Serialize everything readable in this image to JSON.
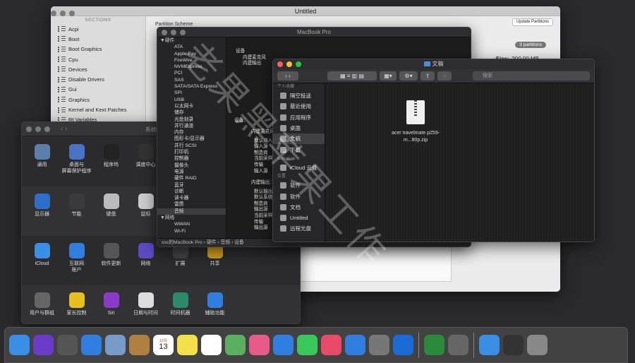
{
  "untitled": {
    "title": "Untitled",
    "sections_header": "SECTIONS",
    "sections": [
      "Acpi",
      "Boot",
      "Boot Graphics",
      "Cpu",
      "Devices",
      "Disable Drivers",
      "Gui",
      "Graphics",
      "Kernel and Kext Patches",
      "Rt Variables"
    ],
    "partition_label": "Partition Scheme",
    "update_btn": "Update Partitions",
    "partitions_badge": "3 partitions",
    "size_label": "Size:",
    "size_value": "200.00 MB"
  },
  "prefs": {
    "title": "系统偏",
    "rows": [
      [
        {
          "label": "通用",
          "icon": "general-icon",
          "color": "#5a7fa8"
        },
        {
          "label": "桌面与\n屏幕保护程序",
          "icon": "desktop-icon",
          "color": "#4a72c4"
        },
        {
          "label": "程序坞",
          "icon": "dock-icon",
          "color": "#222"
        },
        {
          "label": "调度中心",
          "icon": "mission-control-icon",
          "color": "#333"
        }
      ],
      [
        {
          "label": "显示器",
          "icon": "display-icon",
          "color": "#2d6fc8"
        },
        {
          "label": "节能",
          "icon": "energy-icon",
          "color": "#3a3a3a"
        },
        {
          "label": "键盘",
          "icon": "keyboard-icon",
          "color": "#bbb"
        },
        {
          "label": "鼠标",
          "icon": "mouse-icon",
          "color": "#ccc"
        }
      ],
      [
        {
          "label": "iCloud",
          "icon": "icloud-icon",
          "color": "#3a8ee6"
        },
        {
          "label": "互联网\n账户",
          "icon": "internet-accounts-icon",
          "color": "#2f7ee0"
        },
        {
          "label": "软件更新",
          "icon": "software-update-icon",
          "color": "#555"
        },
        {
          "label": "网络",
          "icon": "network-icon",
          "color": "#5b4cc4"
        },
        {
          "label": "扩展",
          "icon": "extensions-icon",
          "color": "#444"
        },
        {
          "label": "共享",
          "icon": "sharing-icon",
          "color": "#d4a020"
        }
      ],
      [
        {
          "label": "用户与群组",
          "icon": "users-icon",
          "color": "#666"
        },
        {
          "label": "家长控制",
          "icon": "parental-icon",
          "color": "#e6c020"
        },
        {
          "label": "Siri",
          "icon": "siri-icon",
          "color": "#8a3ac8"
        },
        {
          "label": "日期与时间",
          "icon": "date-time-icon",
          "color": "#ddd"
        },
        {
          "label": "时间机器",
          "icon": "time-machine-icon",
          "color": "#2a8a6a"
        },
        {
          "label": "辅助功能",
          "icon": "accessibility-icon",
          "color": "#2f7ee0"
        }
      ]
    ]
  },
  "info": {
    "title": "MacBook Pro",
    "tree": [
      {
        "t": "▼硬件",
        "h": true
      },
      {
        "t": "ATA"
      },
      {
        "t": "Apple Pay"
      },
      {
        "t": "FireWire"
      },
      {
        "t": "NVMExpress"
      },
      {
        "t": "PCI"
      },
      {
        "t": "SAS"
      },
      {
        "t": "SATA/SATA Express"
      },
      {
        "t": "SPI"
      },
      {
        "t": "USB"
      },
      {
        "t": "以太网卡"
      },
      {
        "t": "储存"
      },
      {
        "t": "光盘刻录"
      },
      {
        "t": "并行通道"
      },
      {
        "t": "内存"
      },
      {
        "t": "图形卡/显示器"
      },
      {
        "t": "并行 SCSI"
      },
      {
        "t": "打印机"
      },
      {
        "t": "控制器"
      },
      {
        "t": "摄像头"
      },
      {
        "t": "电源"
      },
      {
        "t": "硬件 RAID"
      },
      {
        "t": "蓝牙"
      },
      {
        "t": "诊断"
      },
      {
        "t": "读卡器"
      },
      {
        "t": "雷雳"
      },
      {
        "t": "音频",
        "sel": true
      },
      {
        "t": "▼网络",
        "h": true
      },
      {
        "t": "WWAN"
      },
      {
        "t": "Wi-Fi"
      }
    ],
    "detail_top": [
      "设备",
      "内建麦克风",
      "内建输出"
    ],
    "detail_head": "设备：",
    "block1_title": "内建麦克风",
    "block1": [
      "默认输入",
      "输入源",
      "制造商",
      "当前采样",
      "传输",
      "输入源"
    ],
    "block2_title": "内建输出：",
    "block2": [
      "默认输出",
      "默认系统",
      "制造商",
      "输出源",
      "当前采样",
      "传输",
      "输出源"
    ],
    "crumb": "xsc的MacBook Pro › 硬件 › 音频 › 设备"
  },
  "finder": {
    "title": "文稿",
    "search_placeholder": "搜索",
    "fav_header": "个人收藏",
    "favorites": [
      "隔空投送",
      "最近使用",
      "应用程序",
      "桌面",
      "文稿",
      "下载"
    ],
    "icloud_header": "iCloud",
    "icloud": [
      "iCloud 云盘"
    ],
    "loc_header": "位置",
    "locations": [
      "软件",
      "软件",
      "文档",
      "Untitled",
      "远程光盘"
    ],
    "file_name": "acer travelmate p259-m...80p.zip"
  },
  "dock": [
    "finder-icon",
    "siri-icon",
    "launchpad-icon",
    "safari-icon",
    "mail-icon",
    "contacts-icon",
    "calendar-icon",
    "notes-icon",
    "reminders-icon",
    "maps-icon",
    "photos-icon",
    "messages-icon",
    "facetime-icon",
    "music-icon",
    "app-store-icon",
    "system-preferences-icon",
    "teamviewer-icon",
    "clover-icon",
    "utility-icon",
    "downloads-folder-icon",
    "screen-icon",
    "trash-icon"
  ],
  "dock_calendar_day": "13",
  "dock_calendar_month": "12月",
  "watermark": "老果黑苹果工作"
}
